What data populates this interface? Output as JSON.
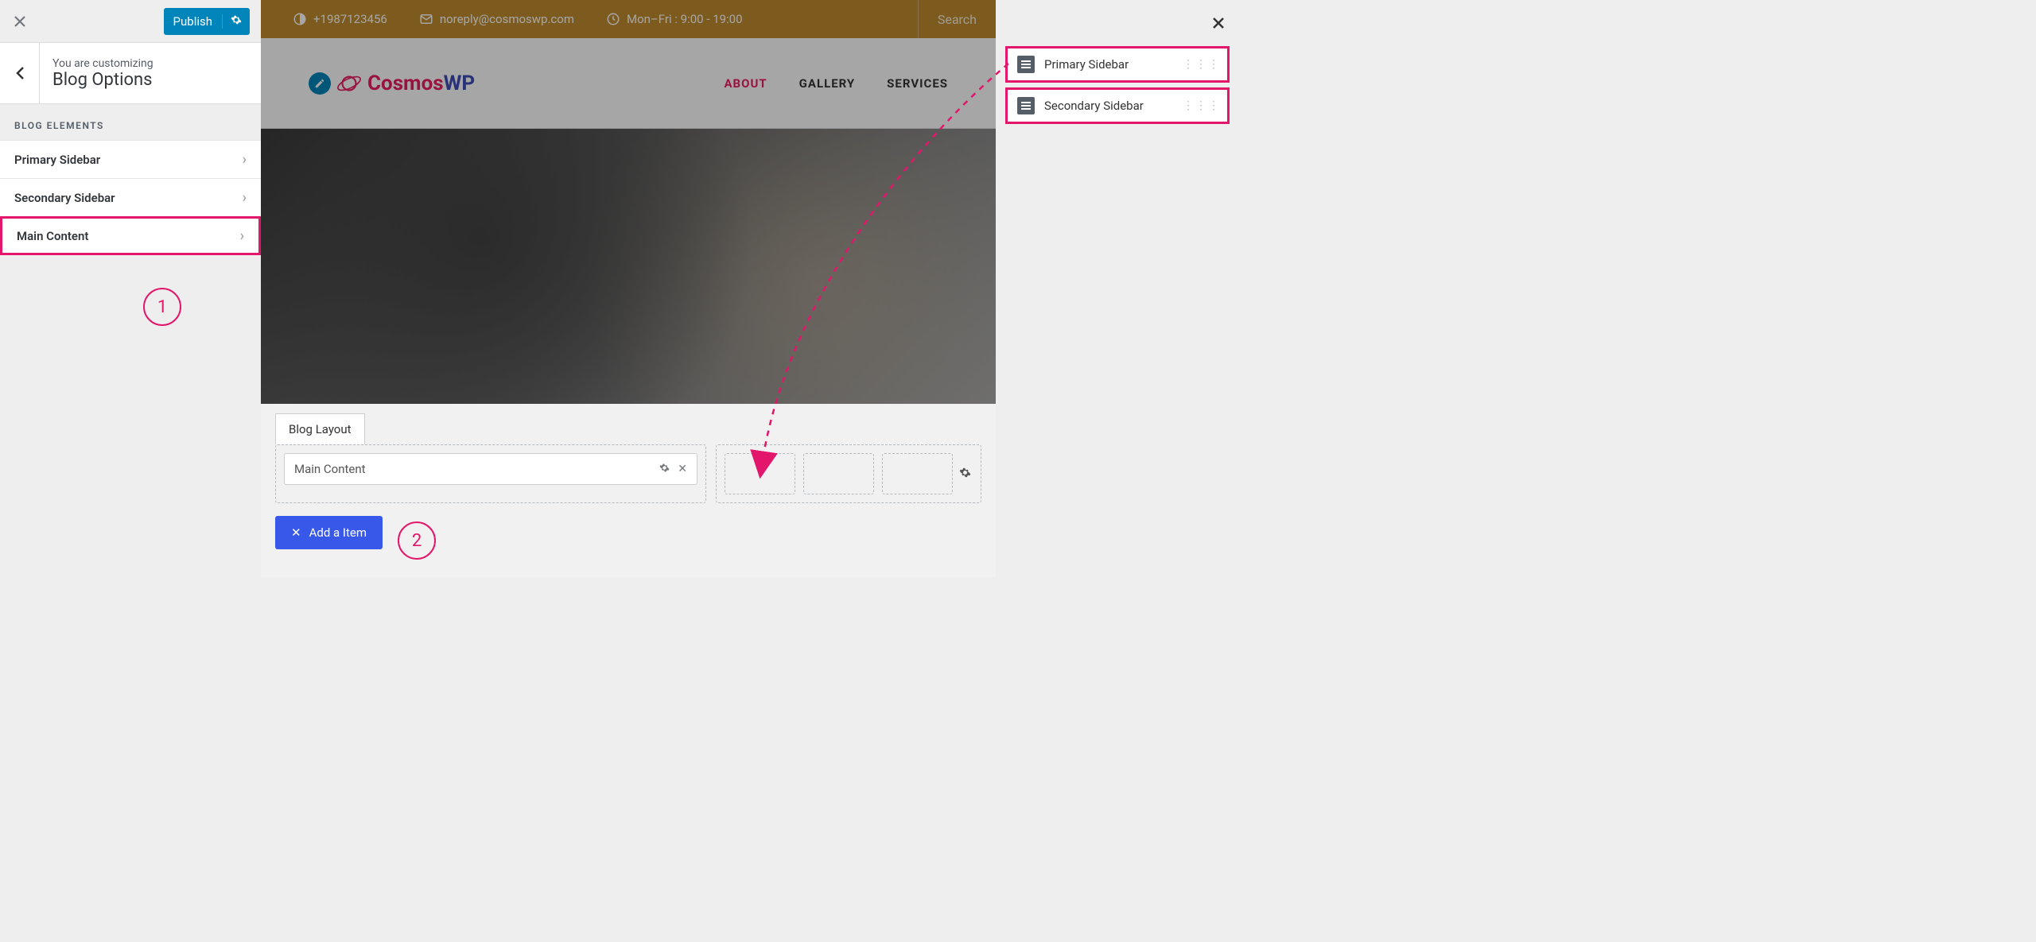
{
  "customizer": {
    "publish_label": "Publish",
    "breadcrumb_sub": "You are customizing",
    "breadcrumb_title": "Blog Options",
    "section_label": "BLOG ELEMENTS",
    "items": [
      {
        "label": "Primary Sidebar",
        "highlighted": false
      },
      {
        "label": "Secondary Sidebar",
        "highlighted": false
      },
      {
        "label": "Main Content",
        "highlighted": true
      }
    ]
  },
  "preview": {
    "topbar": {
      "phone": "+1987123456",
      "email": "noreply@cosmoswp.com",
      "hours": "Mon–Fri : 9:00 - 19:00",
      "search_placeholder": "Search"
    },
    "logo": {
      "cosmos": "Cosmos",
      "wp": "WP"
    },
    "nav": [
      {
        "label": "ABOUT",
        "active": true
      },
      {
        "label": "GALLERY",
        "active": false
      },
      {
        "label": "SERVICES",
        "active": false
      }
    ],
    "tab_label": "Blog Layout",
    "layout_item_label": "Main Content",
    "add_item_label": "Add a Item"
  },
  "right_panel": {
    "items": [
      {
        "label": "Primary Sidebar"
      },
      {
        "label": "Secondary Sidebar"
      }
    ]
  },
  "annotations": {
    "n1": "1",
    "n2": "2"
  }
}
